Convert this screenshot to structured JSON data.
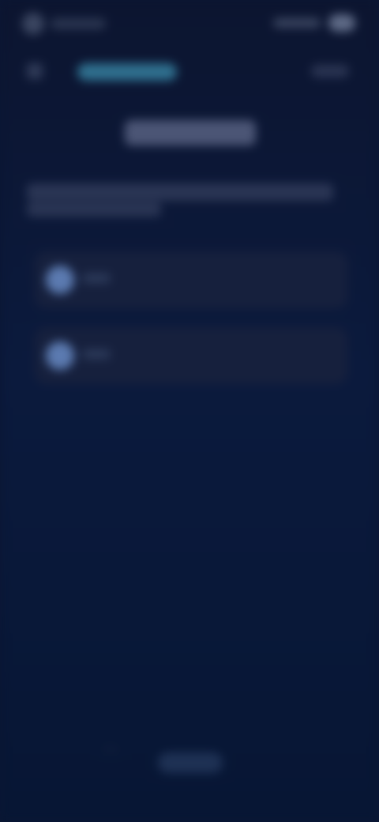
{
  "status_bar": {},
  "nav": {},
  "page": {},
  "options": [
    {},
    {}
  ],
  "footer": {},
  "colors": {
    "background_top": "#0c1530",
    "background_bottom": "#071634",
    "accent": "#2f6f8e",
    "radio": "#5b7ab0",
    "card": "#16203d"
  }
}
